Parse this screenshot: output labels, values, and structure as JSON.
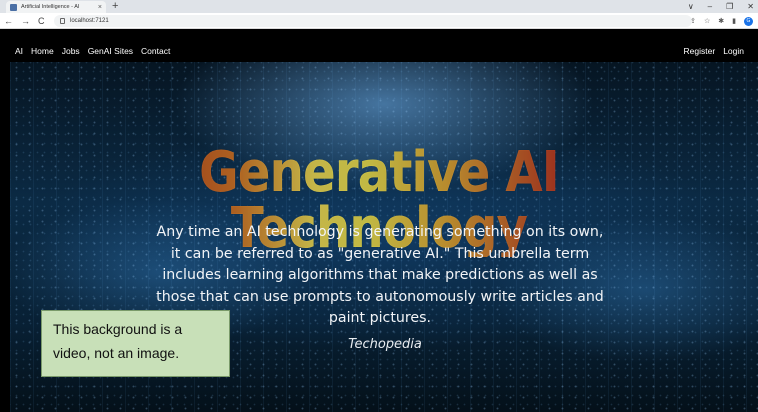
{
  "browser": {
    "tab_title": "Artificial Intelligence - AI",
    "tab_close": "×",
    "new_tab": "+",
    "url": "localhost:7121",
    "nav": [
      "←",
      "→",
      "C"
    ],
    "window_controls": [
      "∨",
      "–",
      "❐",
      "✕"
    ],
    "toolbar_icons": [
      "share-icon",
      "star-icon",
      "extensions-icon",
      "sidepanel-icon"
    ],
    "profile_initial": "G"
  },
  "navbar": {
    "brand": "AI",
    "links": [
      "Home",
      "Jobs",
      "GenAI Sites",
      "Contact"
    ],
    "right_links": [
      "Register",
      "Login"
    ]
  },
  "hero": {
    "headline": "Generative AI Technology",
    "body": "Any time an AI technology is generating something on its own, it can be referred to as \"generative AI.\" This umbrella term includes learning algorithms that make predictions as well as those that can use prompts to autonomously write articles and paint pictures.",
    "source": "Techopedia"
  },
  "callout": {
    "text": "This background is a video, not an image."
  },
  "colors": {
    "navbar_bg": "#000000",
    "callout_bg": "#c8e0b8",
    "headline_gradient": [
      "#b8331c",
      "#f5e35a",
      "#a52a20"
    ]
  }
}
